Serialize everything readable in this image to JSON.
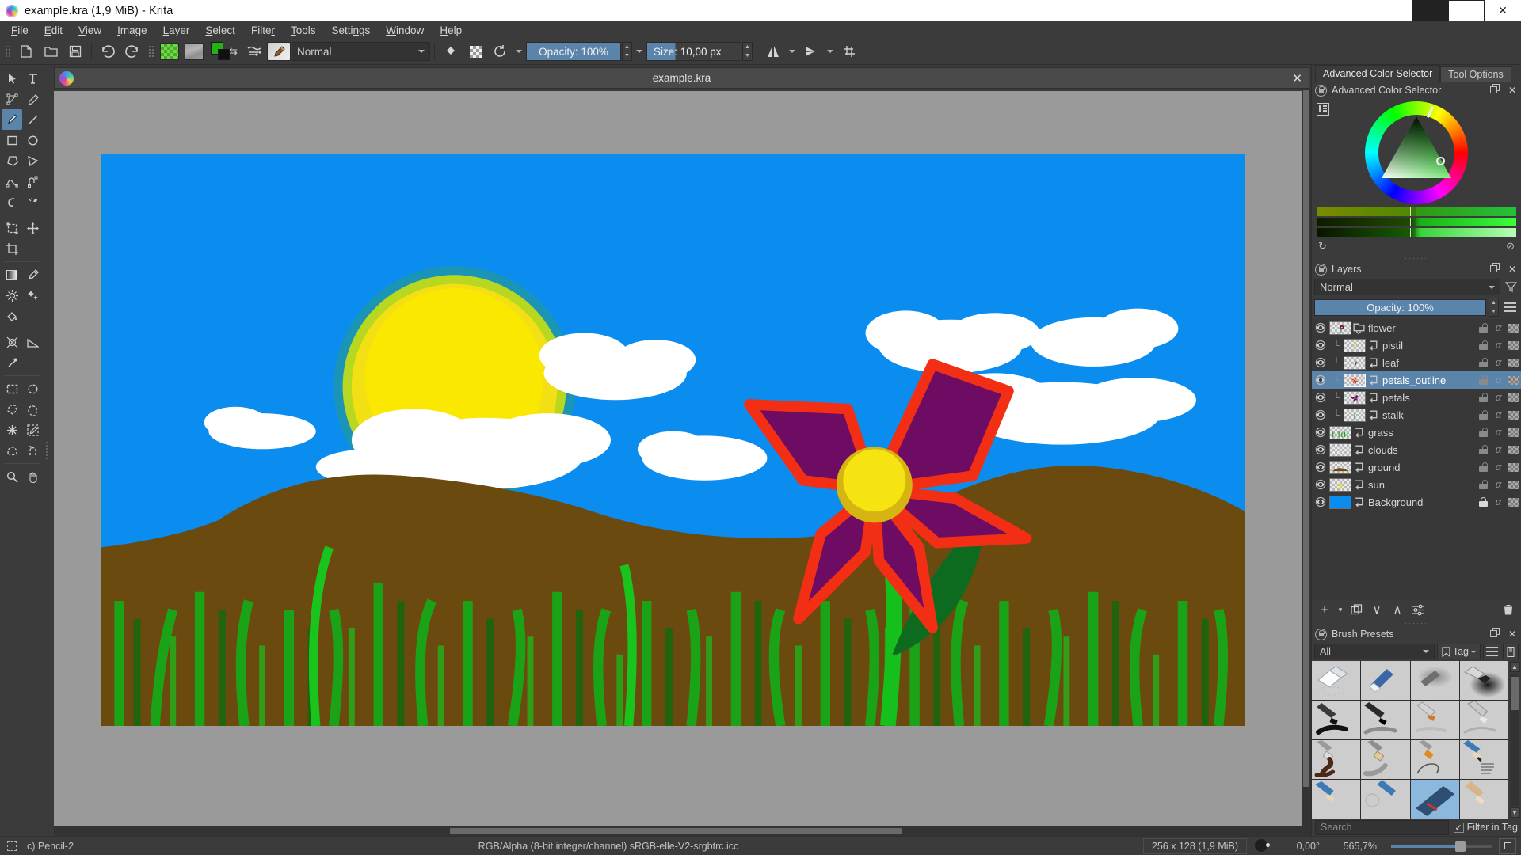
{
  "window": {
    "title": "example.kra (1,9 MiB)  - Krita",
    "app_icon": "krita-logo-icon",
    "minimize": "minimize-icon",
    "maximize": "restore-icon",
    "close": "close-icon"
  },
  "menubar": {
    "items": [
      {
        "label": "File",
        "accel": "F"
      },
      {
        "label": "Edit",
        "accel": "E"
      },
      {
        "label": "View",
        "accel": "V"
      },
      {
        "label": "Image",
        "accel": "I"
      },
      {
        "label": "Layer",
        "accel": "L"
      },
      {
        "label": "Select",
        "accel": "S"
      },
      {
        "label": "Filter",
        "accel": "r"
      },
      {
        "label": "Tools",
        "accel": "T"
      },
      {
        "label": "Settings",
        "accel": "n"
      },
      {
        "label": "Window",
        "accel": "W"
      },
      {
        "label": "Help",
        "accel": "H"
      }
    ]
  },
  "toolbar": {
    "new_label": "new-document-icon",
    "open_label": "open-document-icon",
    "save_label": "save-document-icon",
    "undo_label": "undo-icon",
    "redo_label": "redo-icon",
    "pattern_label": "pattern-swatch",
    "gradient_label": "gradient-swatch",
    "fgcolor": "#22b314",
    "bgcolor": "#111111",
    "swap_label": "swap-colors-icon",
    "presets_label": "brush-presets-icon",
    "brush_editor_label": "brush-editor-icon",
    "blending_mode": "Normal",
    "eraser_label": "eraser-mode-icon",
    "alpha_label": "preserve-alpha-icon",
    "reload_label": "reload-preset-icon",
    "opacity": "Opacity: 100%",
    "size": "Size: 10,00 px",
    "mirror_h_label": "mirror-horizontal-icon",
    "mirror_v_label": "mirror-vertical-icon",
    "wraparound_label": "wrap-around-mode-icon"
  },
  "toolbox": {
    "tools": [
      {
        "name": "select-shapes-tool",
        "glyph": "➤",
        "selected": false
      },
      {
        "name": "text-tool",
        "glyph": "T",
        "selected": false
      },
      {
        "name": "edit-shapes-tool",
        "glyph": "⬟",
        "selected": false
      },
      {
        "name": "calligraphy-tool",
        "glyph": "✒",
        "selected": false
      },
      {
        "name": "freehand-brush-tool",
        "glyph": "✎",
        "selected": true
      },
      {
        "name": "line-tool",
        "glyph": "╱",
        "selected": false
      },
      {
        "name": "rectangle-tool",
        "glyph": "□",
        "selected": false
      },
      {
        "name": "ellipse-tool",
        "glyph": "○",
        "selected": false
      },
      {
        "name": "polygon-tool",
        "glyph": "⬠",
        "selected": false
      },
      {
        "name": "polyline-tool",
        "glyph": "▷",
        "selected": false
      },
      {
        "name": "bezier-curve-tool",
        "glyph": "⌒",
        "selected": false
      },
      {
        "name": "freehand-path-tool",
        "glyph": "⌇",
        "selected": false
      },
      {
        "name": "dynamic-brush-tool",
        "glyph": "ɔ",
        "selected": false
      },
      {
        "name": "multibrush-tool",
        "glyph": "❆",
        "selected": false
      },
      {
        "name": "transform-tool",
        "glyph": "⬚",
        "selected": false
      },
      {
        "name": "move-tool",
        "glyph": "✥",
        "selected": false
      },
      {
        "name": "crop-tool",
        "glyph": "⌗",
        "selected": false
      },
      {
        "name": "gradient-tool",
        "glyph": "▨",
        "selected": false
      },
      {
        "name": "color-picker-tool",
        "glyph": "✐",
        "selected": false
      },
      {
        "name": "colorize-mask-tool",
        "glyph": "✹",
        "selected": false
      },
      {
        "name": "smart-patch-tool",
        "glyph": "✦",
        "selected": false
      },
      {
        "name": "fill-tool",
        "glyph": "◢",
        "selected": false
      },
      {
        "name": "assistant-tool",
        "glyph": "⨂",
        "selected": false
      },
      {
        "name": "measure-tool",
        "glyph": "◥",
        "selected": false
      },
      {
        "name": "reference-images-tool",
        "glyph": "⚑",
        "selected": false
      },
      {
        "name": "rectangular-selection-tool",
        "glyph": "⬚",
        "selected": false
      },
      {
        "name": "elliptical-selection-tool",
        "glyph": "◌",
        "selected": false
      },
      {
        "name": "polygonal-selection-tool",
        "glyph": "⬡",
        "selected": false
      },
      {
        "name": "freehand-selection-tool",
        "glyph": "⤵",
        "selected": false
      },
      {
        "name": "contiguous-selection-tool",
        "glyph": "✳",
        "selected": false
      },
      {
        "name": "similar-color-selection-tool",
        "glyph": "✒",
        "selected": false
      },
      {
        "name": "bezier-selection-tool",
        "glyph": "⬭",
        "selected": false
      },
      {
        "name": "magnetic-selection-tool",
        "glyph": "⌒",
        "selected": false
      },
      {
        "name": "zoom-tool",
        "glyph": "⚲",
        "selected": false
      },
      {
        "name": "pan-tool",
        "glyph": "✋",
        "selected": false
      }
    ]
  },
  "document_tab": {
    "name": "example.kra",
    "icon": "krita-document-icon",
    "close": "✕"
  },
  "canvas": {
    "artwork_title": "sunny landscape with flower",
    "sky_color": "#0b8df0",
    "ground_color": "#6b4a10",
    "grass_color": "#16a818",
    "sun_color": "#f5e312",
    "cloud_color": "#ffffff",
    "petal_color": "#6e0b63",
    "petal_outline_color": "#f22f14",
    "pistil_color": "#f5e312",
    "leaf_color": "#0d6b20",
    "stalk_color": "#16c01c"
  },
  "color_selector": {
    "tab_active": "Advanced Color Selector",
    "tab_inactive": "Tool Options",
    "dock_title": "Advanced Color Selector",
    "settings_icon": "color-selector-settings-icon",
    "float_icon": "float-dock-icon",
    "close_icon": "close-dock-icon",
    "reset_icon": "reset-color-icon",
    "clear_icon": "clear-color-icon",
    "selected_hue_deg": 120
  },
  "layers": {
    "dock_title": "Layers",
    "float_icon": "float-dock-icon",
    "close_icon": "close-dock-icon",
    "blending_mode": "Normal",
    "filter_icon": "filter-layers-icon",
    "opacity": "Opacity:  100%",
    "menu_icon": "layers-menu-icon",
    "rows": [
      {
        "name": "flower",
        "indent": 0,
        "type": "group",
        "selected": false,
        "locked": false,
        "visible": true
      },
      {
        "name": "pistil",
        "indent": 1,
        "type": "paint",
        "selected": false,
        "locked": false,
        "visible": true
      },
      {
        "name": "leaf",
        "indent": 1,
        "type": "paint",
        "selected": false,
        "locked": false,
        "visible": true
      },
      {
        "name": "petals_outline",
        "indent": 1,
        "type": "paint",
        "selected": true,
        "locked": false,
        "visible": true
      },
      {
        "name": "petals",
        "indent": 1,
        "type": "paint",
        "selected": false,
        "locked": false,
        "visible": true
      },
      {
        "name": "stalk",
        "indent": 1,
        "type": "paint",
        "selected": false,
        "locked": false,
        "visible": true
      },
      {
        "name": "grass",
        "indent": 0,
        "type": "paint",
        "selected": false,
        "locked": false,
        "visible": true
      },
      {
        "name": "clouds",
        "indent": 0,
        "type": "paint",
        "selected": false,
        "locked": false,
        "visible": true
      },
      {
        "name": "ground",
        "indent": 0,
        "type": "paint",
        "selected": false,
        "locked": false,
        "visible": true
      },
      {
        "name": "sun",
        "indent": 0,
        "type": "paint",
        "selected": false,
        "locked": false,
        "visible": true
      },
      {
        "name": "Background",
        "indent": 0,
        "type": "paint",
        "selected": false,
        "locked": true,
        "visible": true
      }
    ],
    "toolbar": {
      "add": "+",
      "add_dropdown": "▾",
      "duplicate": "duplicate-layer-icon",
      "move_down": "∨",
      "move_up": "∧",
      "properties": "layer-properties-icon",
      "delete": "delete-layer-icon"
    }
  },
  "brush_presets": {
    "dock_title": "Brush Presets",
    "float_icon": "float-dock-icon",
    "close_icon": "close-dock-icon",
    "tag_filter": "All",
    "tag_label": "Tag",
    "menu_icon": "presets-menu-icon",
    "storage_icon": "resource-storage-icon",
    "search_placeholder": "Search",
    "filter_in_tag_label": "Filter in Tag",
    "filter_in_tag_checked": true,
    "cells": [
      {
        "name": "eraser-soft",
        "selected": false
      },
      {
        "name": "eraser-small",
        "selected": false
      },
      {
        "name": "airbrush-soft",
        "selected": false
      },
      {
        "name": "ink-pen-round",
        "selected": false
      },
      {
        "name": "ink-ballpoint",
        "selected": false
      },
      {
        "name": "ink-marker",
        "selected": false
      },
      {
        "name": "ink-gpen",
        "selected": false
      },
      {
        "name": "ink-fineliner",
        "selected": false
      },
      {
        "name": "paint-brush-wet",
        "selected": false
      },
      {
        "name": "paint-brush-dry",
        "selected": false
      },
      {
        "name": "paint-brush-thin",
        "selected": false
      },
      {
        "name": "pencil-hard",
        "selected": false
      },
      {
        "name": "pencil-soft",
        "selected": false
      },
      {
        "name": "pencil-2",
        "selected": false
      },
      {
        "name": "pencil-sketch",
        "selected": true
      },
      {
        "name": "pencil-tilt",
        "selected": false
      }
    ]
  },
  "statusbar": {
    "selection_icon": "selection-mask-icon",
    "brush_preset": "c) Pencil-2",
    "color_space": "RGB/Alpha (8-bit integer/channel)  sRGB-elle-V2-srgbtrc.icc",
    "dimensions": "256 x 128 (1,9 MiB)",
    "rotation_icon": "canvas-rotation-icon",
    "rotation": "0,00°",
    "zoom": "565,7%",
    "fit_icon": "fit-page-icon"
  }
}
